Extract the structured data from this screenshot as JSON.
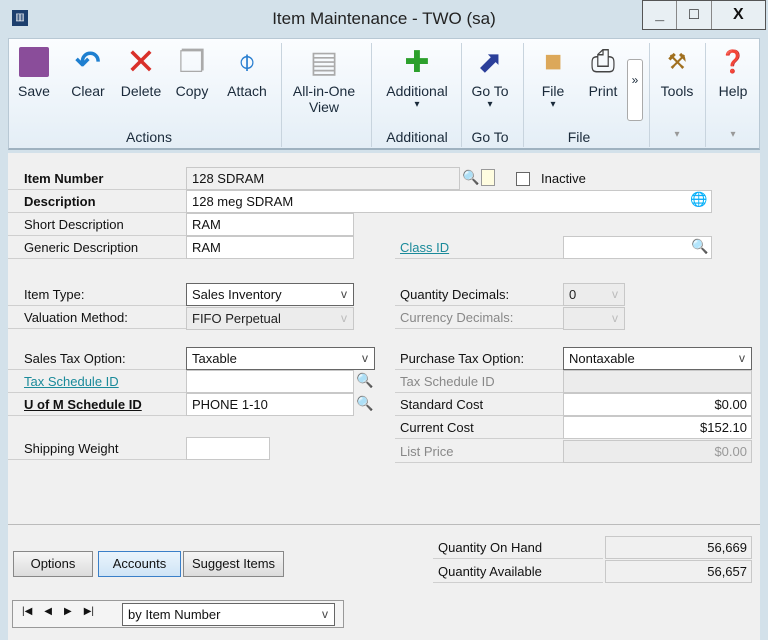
{
  "window": {
    "title": "Item Maintenance  -  TWO (sa)",
    "minimize": "_",
    "maximize": "□",
    "close": "X"
  },
  "toolbar": {
    "save": "Save",
    "clear": "Clear",
    "delete": "Delete",
    "copy": "Copy",
    "attach": "Attach",
    "all_in_one": "All-in-One",
    "all_in_one_2": "View",
    "additional": "Additional",
    "goto": "Go To",
    "file": "File",
    "print": "Print",
    "more": "»",
    "tools": "Tools",
    "help": "Help",
    "groups": {
      "actions": "Actions",
      "additional": "Additional",
      "goto": "Go To",
      "file": "File"
    },
    "arrow": "▾"
  },
  "form": {
    "item_number_label": "Item Number",
    "item_number": "128 SDRAM",
    "inactive_label": "Inactive",
    "description_label": "Description",
    "description": "128 meg SDRAM",
    "short_description_label": "Short Description",
    "short_description": "RAM",
    "generic_description_label": "Generic Description",
    "generic_description": "RAM",
    "class_id_label": "Class ID",
    "class_id": "",
    "item_type_label": "Item Type:",
    "item_type": "Sales Inventory",
    "valuation_label": "Valuation Method:",
    "valuation": "FIFO Perpetual",
    "qty_decimals_label": "Quantity Decimals:",
    "qty_decimals": "0",
    "currency_decimals_label": "Currency Decimals:",
    "currency_decimals": "",
    "sales_tax_label": "Sales Tax Option:",
    "sales_tax": "Taxable",
    "tax_schedule_label": "Tax Schedule ID",
    "tax_schedule": "",
    "uofm_label": "U of M Schedule ID",
    "uofm": "PHONE 1-10",
    "shipping_weight_label": "Shipping Weight",
    "shipping_weight": "",
    "purchase_tax_label": "Purchase Tax Option:",
    "purchase_tax": "Nontaxable",
    "purchase_tax_schedule_label": "Tax Schedule ID",
    "purchase_tax_schedule": "",
    "standard_cost_label": "Standard Cost",
    "standard_cost": "$0.00",
    "current_cost_label": "Current Cost",
    "current_cost": "$152.10",
    "list_price_label": "List Price",
    "list_price": "$0.00",
    "qty_on_hand_label": "Quantity On Hand",
    "qty_on_hand": "56,669",
    "qty_available_label": "Quantity Available",
    "qty_available": "56,657"
  },
  "buttons": {
    "options": "Options",
    "accounts": "Accounts",
    "suggest_items": "Suggest Items"
  },
  "nav": {
    "first": "|◀",
    "prev": "◀",
    "next": "▶",
    "last": "▶|",
    "sort": "by Item Number"
  }
}
